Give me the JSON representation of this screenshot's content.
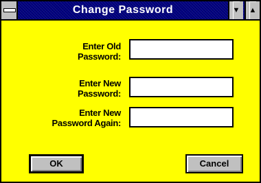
{
  "window": {
    "title": "Change Password"
  },
  "form": {
    "old_password": {
      "label_line1": "Enter Old",
      "label_line2": "Password:",
      "value": ""
    },
    "new_password": {
      "label_line1": "Enter New",
      "label_line2": "Password:",
      "value": ""
    },
    "confirm_password": {
      "label_line1": "Enter New",
      "label_line2": "Password Again:",
      "value": ""
    }
  },
  "buttons": {
    "ok_label": "OK",
    "cancel_label": "Cancel"
  },
  "colors": {
    "background": "#ffff00",
    "titlebar": "#000080",
    "button_face": "#c0c0c0"
  },
  "icons": {
    "system_menu": "system-menu-icon",
    "minimize": "minimize-arrow-icon",
    "maximize": "maximize-arrow-icon"
  }
}
